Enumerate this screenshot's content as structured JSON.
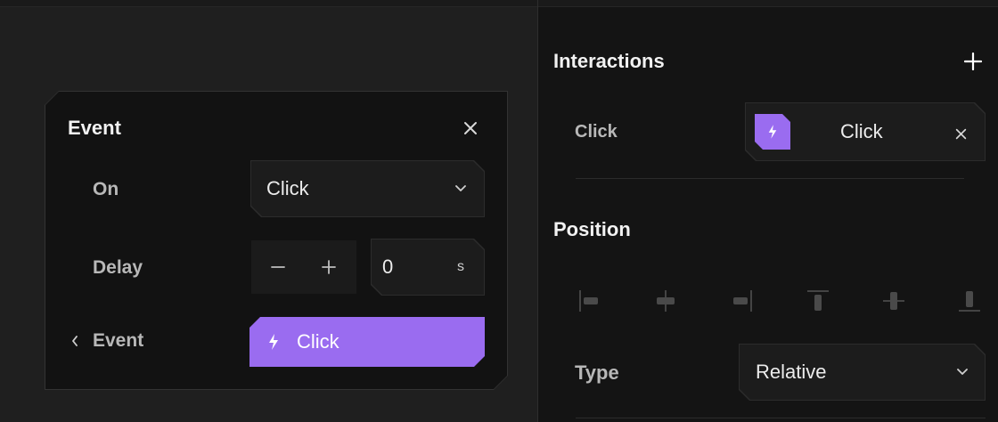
{
  "event_popup": {
    "title": "Event",
    "on_label": "On",
    "on_value": "Click",
    "delay_label": "Delay",
    "delay_value": "0",
    "delay_unit": "s",
    "event_label": "Event",
    "event_value": "Click"
  },
  "sidebar": {
    "interactions_title": "Interactions",
    "interaction_trigger": "Click",
    "interaction_value": "Click",
    "position_title": "Position",
    "type_label": "Type",
    "type_value": "Relative"
  },
  "colors": {
    "accent": "#9a6cf0",
    "panel": "#141414",
    "canvas": "#1f1f1f"
  },
  "icons": [
    "close-icon",
    "chevron-down-icon",
    "minus-icon",
    "plus-icon",
    "lightning-icon",
    "chevron-left-icon",
    "add-icon",
    "align-left-icon",
    "align-center-h-icon",
    "align-right-icon",
    "align-top-icon",
    "align-center-v-icon",
    "align-bottom-icon"
  ]
}
